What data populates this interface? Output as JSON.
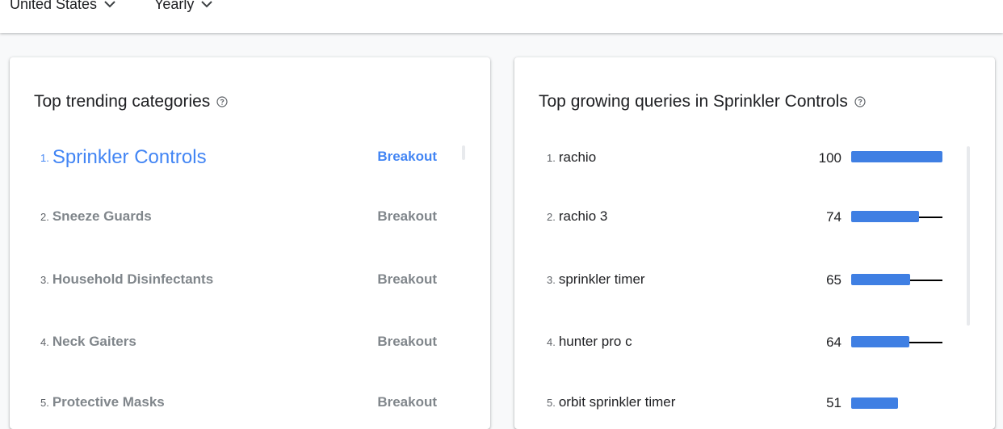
{
  "filters": {
    "region": "United States",
    "period": "Yearly"
  },
  "categories_card": {
    "title": "Top trending categories",
    "items": [
      {
        "rank": "1.",
        "name": "Sprinkler Controls",
        "status": "Breakout"
      },
      {
        "rank": "2.",
        "name": "Sneeze Guards",
        "status": "Breakout"
      },
      {
        "rank": "3.",
        "name": "Household Disinfectants",
        "status": "Breakout"
      },
      {
        "rank": "4.",
        "name": "Neck Gaiters",
        "status": "Breakout"
      },
      {
        "rank": "5.",
        "name": "Protective Masks",
        "status": "Breakout"
      }
    ]
  },
  "queries_card": {
    "title": "Top growing queries in Sprinkler Controls",
    "items": [
      {
        "rank": "1.",
        "name": "rachio",
        "value": "100",
        "level": 100
      },
      {
        "rank": "2.",
        "name": "rachio 3",
        "value": "74",
        "level": 74
      },
      {
        "rank": "3.",
        "name": "sprinkler timer",
        "value": "65",
        "level": 65
      },
      {
        "rank": "4.",
        "name": "hunter pro c",
        "value": "64",
        "level": 64
      },
      {
        "rank": "5.",
        "name": "orbit sprinkler timer",
        "value": "51",
        "level": 51
      }
    ]
  },
  "colors": {
    "accent": "#4285f4",
    "bar": "#3f7fe3",
    "muted": "#80868b"
  },
  "icons": {
    "dropdown": "chevron-down-icon",
    "help": "help-circle-icon"
  }
}
